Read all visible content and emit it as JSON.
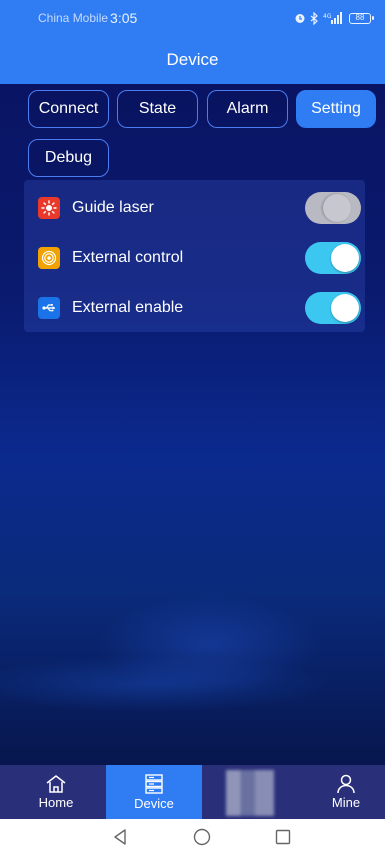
{
  "status_bar": {
    "carrier": "China Mobile",
    "time": "3:05",
    "battery": "88"
  },
  "header": {
    "title": "Device"
  },
  "tabs": [
    {
      "label": "Connect",
      "active": false
    },
    {
      "label": "State",
      "active": false
    },
    {
      "label": "Alarm",
      "active": false
    },
    {
      "label": "Setting",
      "active": true
    },
    {
      "label": "Debug",
      "active": false
    }
  ],
  "settings": [
    {
      "label": "Guide laser",
      "icon": "laser-sun-icon",
      "icon_color": "#e8392a",
      "enabled": false
    },
    {
      "label": "External control",
      "icon": "target-rings-icon",
      "icon_color": "#f2a200",
      "enabled": true
    },
    {
      "label": "External enable",
      "icon": "usb-icon",
      "icon_color": "#1a73e8",
      "enabled": true
    }
  ],
  "bottom_nav": [
    {
      "label": "Home",
      "icon": "home-icon",
      "active": false
    },
    {
      "label": "Device",
      "icon": "device-list-icon",
      "active": true
    },
    {
      "label": "",
      "icon": "blurred-icon",
      "active": false
    },
    {
      "label": "Mine",
      "icon": "person-icon",
      "active": false
    }
  ],
  "colors": {
    "primary": "#2f7cf3",
    "toggle_on": "#3cc7f0",
    "toggle_off": "#b8b9c2"
  }
}
